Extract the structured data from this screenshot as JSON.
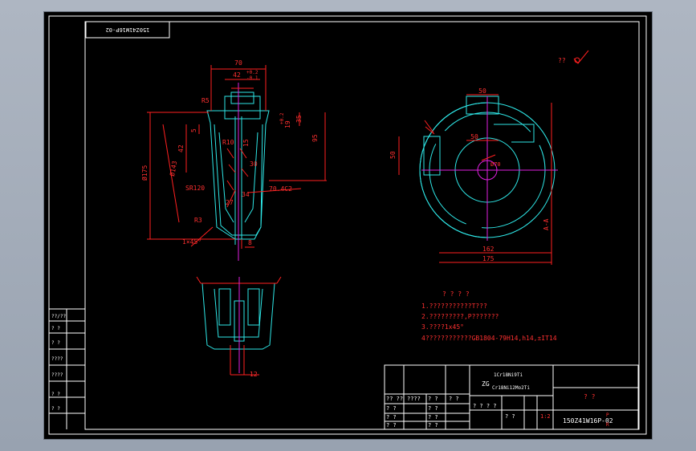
{
  "title_box": {
    "code_mirrored": "150Z41W16P-02"
  },
  "top_right": {
    "roughness_text": "??"
  },
  "dims_front": {
    "d70": "70",
    "d42": "42",
    "d42_tol_upper": "+0.2",
    "d42_tol_lower": "-0.1",
    "r5": "R5",
    "d5": "5",
    "d42v": "42",
    "d143": "Ø143",
    "d175": "Ø175",
    "sr120": "SR120",
    "d19": "19",
    "d19tol": "+0.2",
    "d35": "35",
    "d95": "95",
    "d15": "15",
    "d30": "30",
    "d34": "34",
    "d27": "27",
    "r10": "R10",
    "c2": "70.4C2",
    "d8": "8",
    "r3": "R3",
    "chamfer": "1×45°"
  },
  "dims_side": {
    "d50t": "50",
    "d50m": "50",
    "d50l": "50",
    "d70": "Ø70",
    "d162": "162",
    "d175": "175",
    "aa": "A-A"
  },
  "dims_section": {
    "d12": "12"
  },
  "notes": {
    "heading": "? ? ? ?",
    "lines": [
      "1.???????????T???",
      "2.?????????,P???????",
      "3.????1x45°",
      "4????????????GB1804-79H14,h14,±IT14"
    ]
  },
  "title_block": {
    "material_top": "1Cr18Ni9Ti",
    "material_prefix": "ZG",
    "material_bottom": "Cr18Ni12Mo2Ti",
    "name": "? ?",
    "code": "150Z41W16P-02",
    "code_super": "P",
    "code_sub": "R",
    "scale": "1:2",
    "row_labels": [
      "?? ??",
      "????",
      "? ?",
      "? ?"
    ],
    "cells": [
      "? ?",
      "? ?",
      "? ?",
      "? ?",
      "? ?",
      "? ?",
      "? ? ? ?",
      "? ?"
    ]
  },
  "left_strip": {
    "labels": [
      "??/??",
      "? ?",
      "? ?",
      "????",
      "????",
      "? ?",
      "? ?"
    ]
  }
}
